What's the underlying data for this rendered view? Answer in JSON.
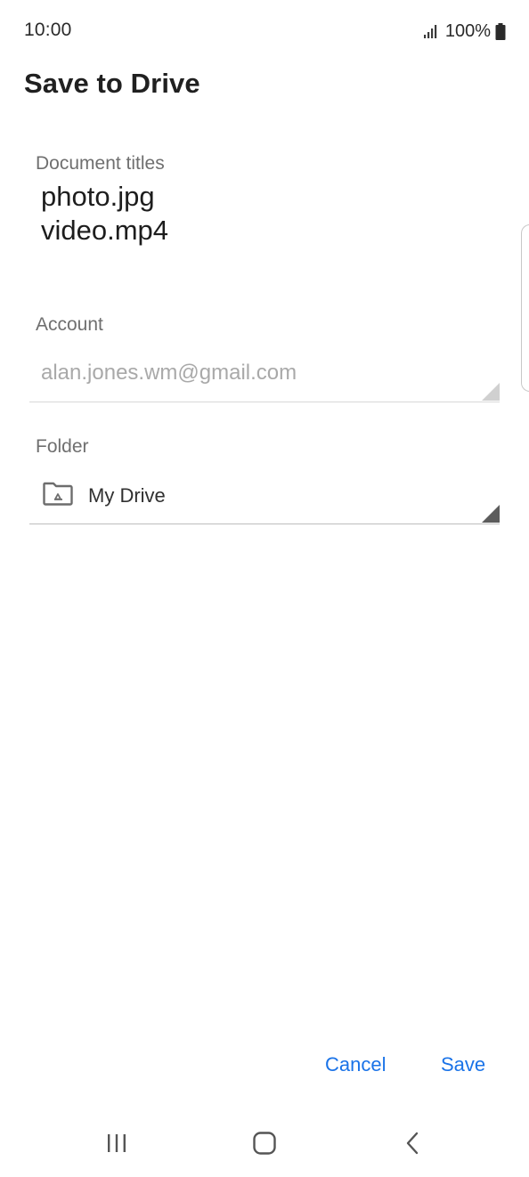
{
  "status_bar": {
    "time": "10:00",
    "battery": "100%",
    "signal_icon": "signal-icon",
    "battery_icon": "battery-icon"
  },
  "page": {
    "title": "Save to Drive"
  },
  "document_titles": {
    "label": "Document titles",
    "items": [
      "photo.jpg",
      "video.mp4"
    ]
  },
  "account": {
    "label": "Account",
    "value": "alan.jones.wm@gmail.com"
  },
  "folder": {
    "label": "Folder",
    "value": "My Drive",
    "icon": "drive-folder-icon"
  },
  "actions": {
    "cancel_label": "Cancel",
    "save_label": "Save"
  },
  "nav_bar": {
    "recents_icon": "recents-icon",
    "home_icon": "home-icon",
    "back_icon": "back-icon"
  },
  "colors": {
    "accent": "#1a73e8",
    "label": "#6f6f6f",
    "account_text": "#a9a9a9"
  }
}
